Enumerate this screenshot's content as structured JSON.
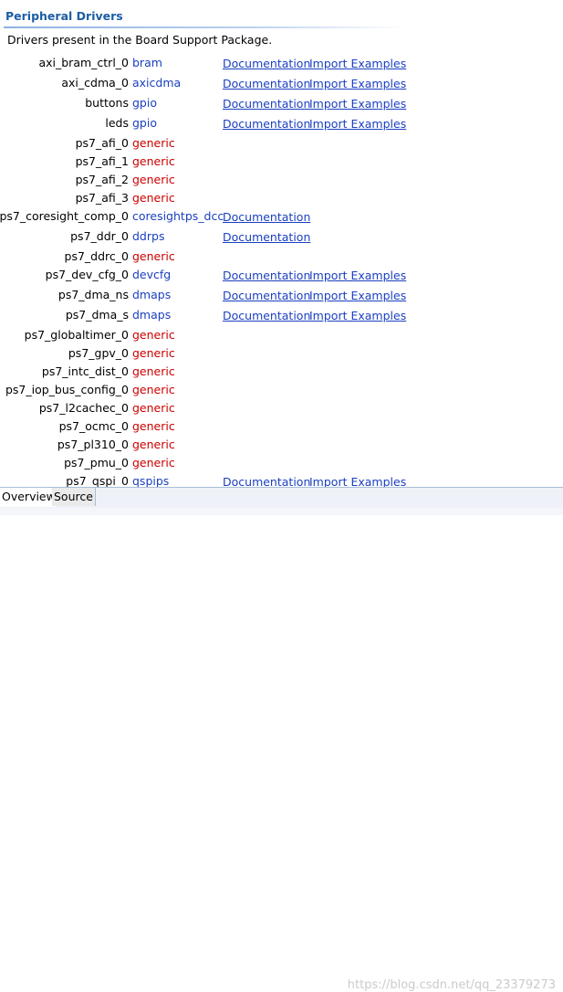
{
  "section": {
    "title": "Peripheral Drivers",
    "description": "Drivers present in the Board Support Package."
  },
  "drivers": [
    {
      "name": "axi_bram_ctrl_0",
      "driver": "bram",
      "kind": "link",
      "doc": "Documentation",
      "examples": "Import Examples"
    },
    {
      "name": "axi_cdma_0",
      "driver": "axicdma",
      "kind": "link",
      "doc": "Documentation",
      "examples": "Import Examples"
    },
    {
      "name": "buttons",
      "driver": "gpio",
      "kind": "link",
      "doc": "Documentation",
      "examples": "Import Examples"
    },
    {
      "name": "leds",
      "driver": "gpio",
      "kind": "link",
      "doc": "Documentation",
      "examples": "Import Examples"
    },
    {
      "name": "ps7_afi_0",
      "driver": "generic",
      "kind": "generic",
      "doc": "",
      "examples": ""
    },
    {
      "name": "ps7_afi_1",
      "driver": "generic",
      "kind": "generic",
      "doc": "",
      "examples": ""
    },
    {
      "name": "ps7_afi_2",
      "driver": "generic",
      "kind": "generic",
      "doc": "",
      "examples": ""
    },
    {
      "name": "ps7_afi_3",
      "driver": "generic",
      "kind": "generic",
      "doc": "",
      "examples": ""
    },
    {
      "name": "ps7_coresight_comp_0",
      "driver": "coresightps_dcc",
      "kind": "link",
      "doc": "Documentation",
      "examples": ""
    },
    {
      "name": "ps7_ddr_0",
      "driver": "ddrps",
      "kind": "link",
      "doc": "Documentation",
      "examples": ""
    },
    {
      "name": "ps7_ddrc_0",
      "driver": "generic",
      "kind": "generic",
      "doc": "",
      "examples": ""
    },
    {
      "name": "ps7_dev_cfg_0",
      "driver": "devcfg",
      "kind": "link",
      "doc": "Documentation",
      "examples": "Import Examples"
    },
    {
      "name": "ps7_dma_ns",
      "driver": "dmaps",
      "kind": "link",
      "doc": "Documentation",
      "examples": "Import Examples"
    },
    {
      "name": "ps7_dma_s",
      "driver": "dmaps",
      "kind": "link",
      "doc": "Documentation",
      "examples": "Import Examples"
    },
    {
      "name": "ps7_globaltimer_0",
      "driver": "generic",
      "kind": "generic",
      "doc": "",
      "examples": ""
    },
    {
      "name": "ps7_gpv_0",
      "driver": "generic",
      "kind": "generic",
      "doc": "",
      "examples": ""
    },
    {
      "name": "ps7_intc_dist_0",
      "driver": "generic",
      "kind": "generic",
      "doc": "",
      "examples": ""
    },
    {
      "name": "ps7_iop_bus_config_0",
      "driver": "generic",
      "kind": "generic",
      "doc": "",
      "examples": ""
    },
    {
      "name": "ps7_l2cachec_0",
      "driver": "generic",
      "kind": "generic",
      "doc": "",
      "examples": ""
    },
    {
      "name": "ps7_ocmc_0",
      "driver": "generic",
      "kind": "generic",
      "doc": "",
      "examples": ""
    },
    {
      "name": "ps7_pl310_0",
      "driver": "generic",
      "kind": "generic",
      "doc": "",
      "examples": ""
    },
    {
      "name": "ps7_pmu_0",
      "driver": "generic",
      "kind": "generic",
      "doc": "",
      "examples": ""
    },
    {
      "name": "ps7_qspi_0",
      "driver": "qspips",
      "kind": "link",
      "doc": "Documentation",
      "examples": "Import Examples"
    }
  ],
  "tabs": [
    {
      "label": "Overview",
      "active": true
    },
    {
      "label": "Source",
      "active": false
    }
  ],
  "watermark": "https://blog.csdn.net/qq_23379273",
  "colors": {
    "title": "#1c5ea4",
    "link": "#1a3fc0",
    "generic": "#cc0000"
  }
}
